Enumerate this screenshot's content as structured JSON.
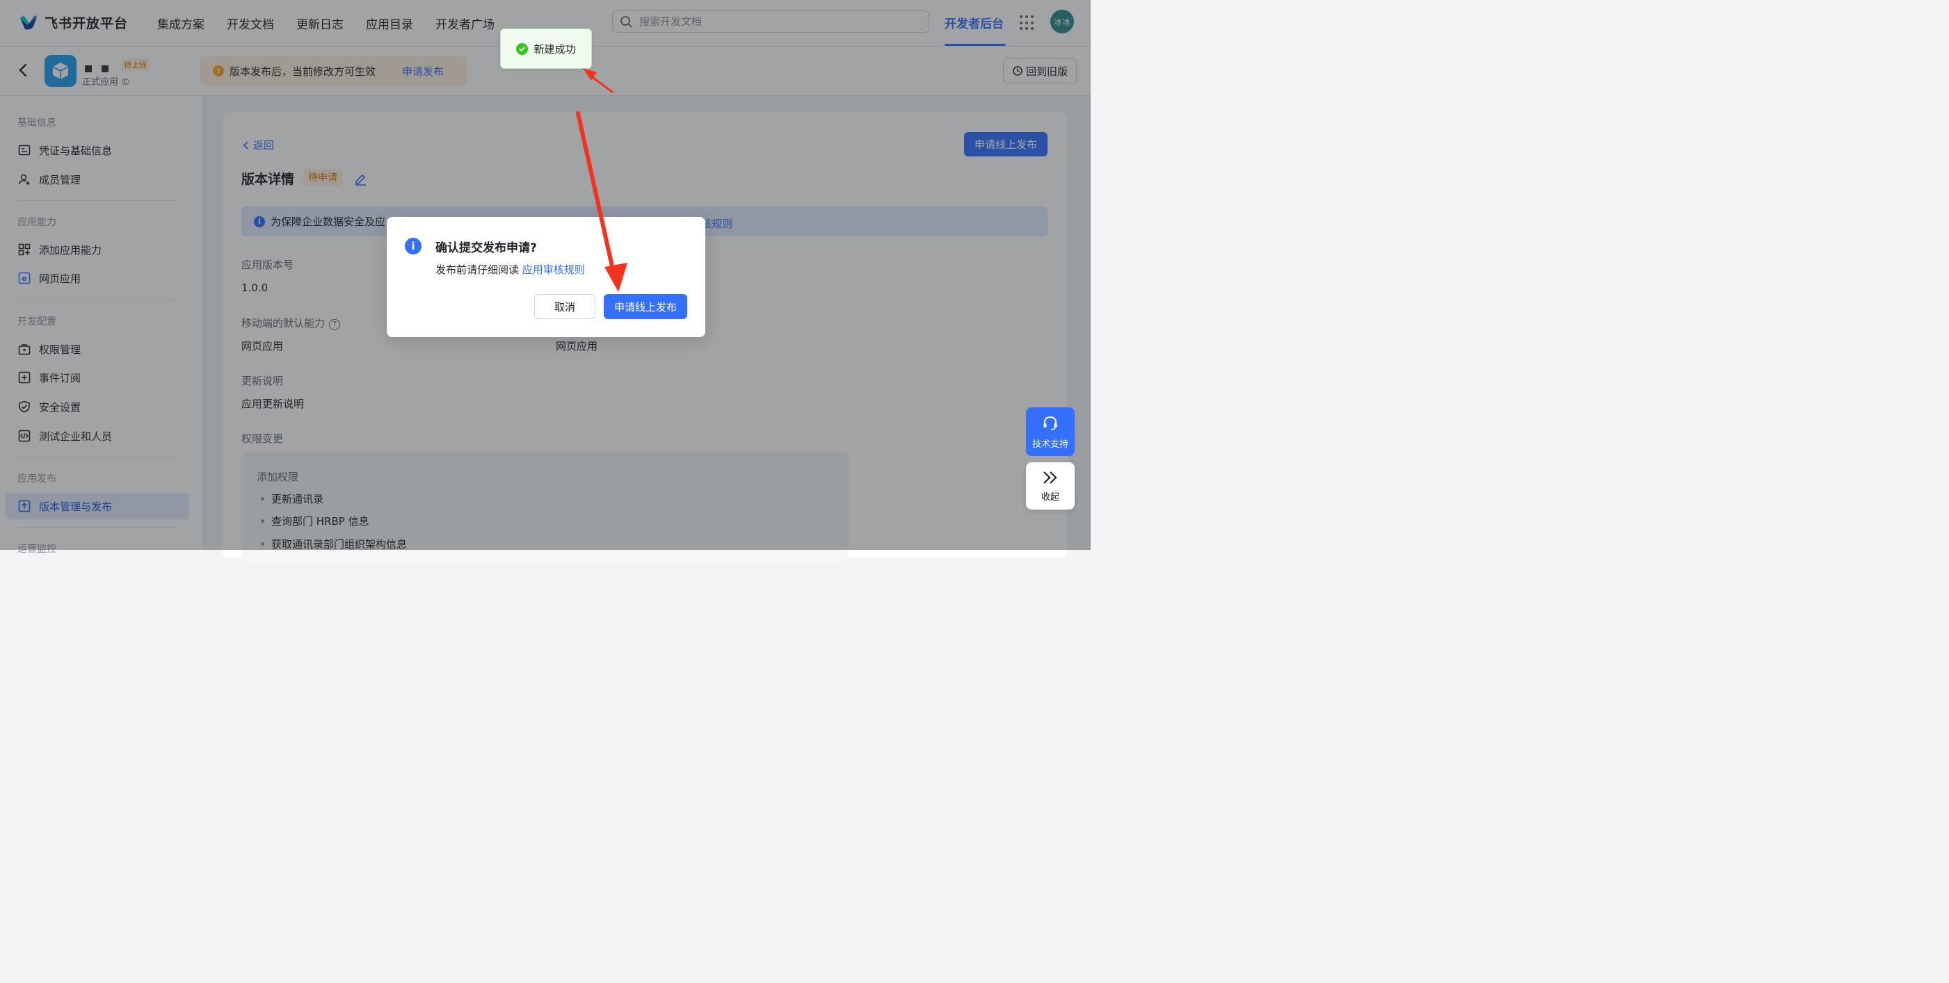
{
  "topnav": {
    "brand": "飞书开放平台",
    "links": [
      "集成方案",
      "开发文档",
      "更新日志",
      "应用目录",
      "开发者广场"
    ],
    "search_placeholder": "搜索开发文档",
    "dev_console": "开发者后台",
    "avatar_text": "冰冰"
  },
  "appbar": {
    "app_badge": "待上线",
    "app_sub": "正式应用 ©",
    "notice_text": "版本发布后，当前修改方可生效",
    "notice_link": "申请发布",
    "old_version_button": "回到旧版"
  },
  "sidebar": {
    "groups": [
      {
        "title": "基础信息",
        "items": [
          "凭证与基础信息",
          "成员管理"
        ]
      },
      {
        "title": "应用能力",
        "items": [
          "添加应用能力",
          "网页应用"
        ]
      },
      {
        "title": "开发配置",
        "items": [
          "权限管理",
          "事件订阅",
          "安全设置",
          "测试企业和人员"
        ]
      },
      {
        "title": "应用发布",
        "items": [
          "版本管理与发布"
        ]
      },
      {
        "title": "运营监控",
        "items": []
      }
    ]
  },
  "main": {
    "back_label": "返回",
    "publish_button": "申请线上发布",
    "title": "版本详情",
    "status": "待申请",
    "info_text": "为保障企业数据安全及应",
    "info_link": "核规则",
    "fields": {
      "version_label": "应用版本号",
      "version_value": "1.0.0",
      "mobile_label": "移动端的默认能力",
      "mobile_value": "网页应用",
      "desktop_value": "网页应用",
      "notes_label": "更新说明",
      "notes_value": "应用更新说明",
      "perm_label": "权限变更"
    },
    "permissions": {
      "head": "添加权限",
      "items": [
        "更新通讯录",
        "查询部门 HRBP 信息",
        "获取通讯录部门组织架构信息"
      ]
    }
  },
  "float": {
    "support_label": "技术支持",
    "collapse_label": "收起"
  },
  "toast": {
    "text": "新建成功"
  },
  "modal": {
    "title": "确认提交发布申请?",
    "desc_prefix": "发布前请仔细阅读",
    "desc_link": "应用审核规则",
    "cancel": "取消",
    "ok": "申请线上发布"
  }
}
